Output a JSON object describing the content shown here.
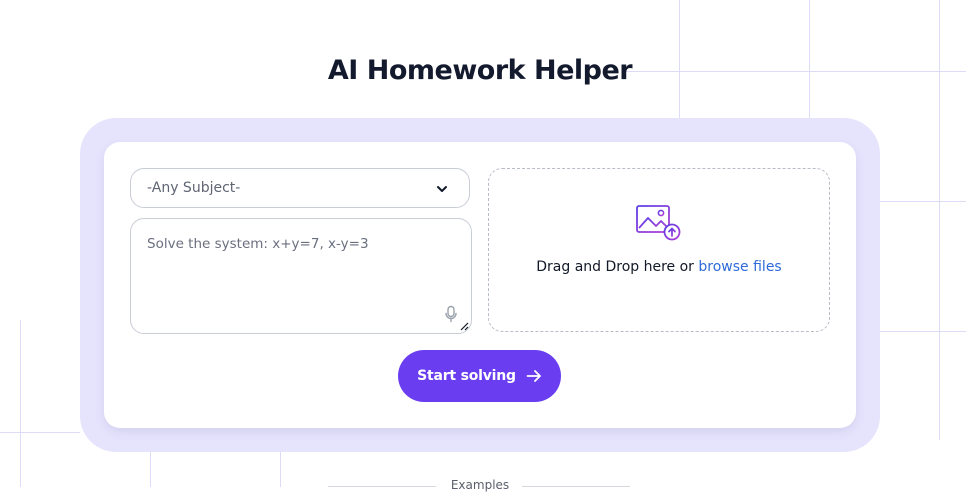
{
  "page": {
    "title": "AI Homework Helper"
  },
  "form": {
    "subject_select": {
      "value": "-Any Subject-"
    },
    "question_input": {
      "placeholder": "Solve the system: x+y=7, x-y=3"
    },
    "dropzone": {
      "text": "Drag and Drop here or ",
      "link": "browse files"
    },
    "submit_label": "Start solving"
  },
  "examples": {
    "label": "Examples"
  },
  "colors": {
    "accent": "#6a3ef0",
    "card_frame": "#e6e4fc",
    "link": "#2f6bd8",
    "title": "#141a2e"
  },
  "icons": {
    "select": "chevron-down-icon",
    "voice": "mic-icon",
    "upload": "upload-image-icon",
    "submit": "arrow-right-icon"
  }
}
